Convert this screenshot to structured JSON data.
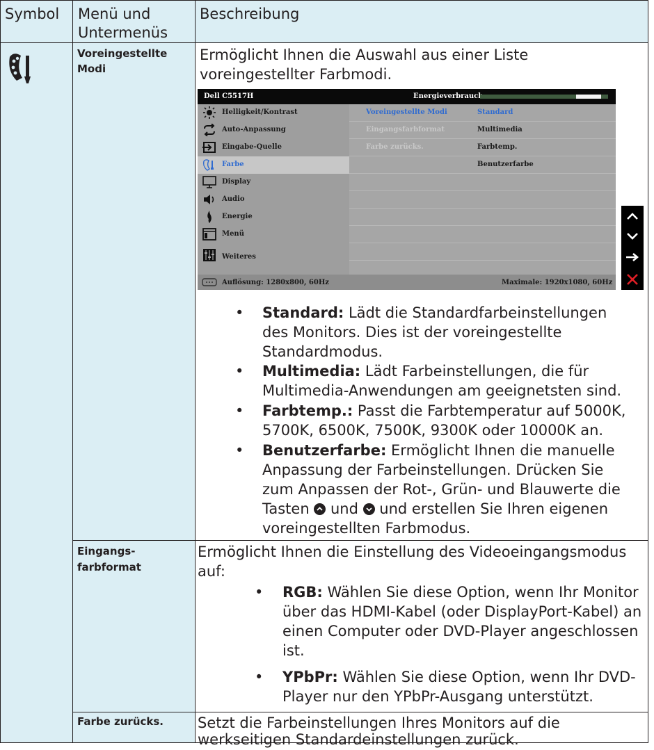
{
  "table_header": {
    "symbol": "Symbol",
    "menu_line1": "Menü und",
    "menu_line2": "Untermenüs",
    "description": "Beschreibung"
  },
  "rows": [
    {
      "menu_line1": "Voreingestellte",
      "menu_line2": "Modi",
      "desc_line1": "Ermöglicht Ihnen die Auswahl aus einer Liste",
      "desc_line2": "voreingestellter Farbmodi.",
      "bullets": [
        {
          "label": "Standard:",
          "lines": [
            " Lädt die Standardfarbeinstellungen",
            "des Monitors. Dies ist der voreingestellte",
            "Standardmodus."
          ]
        },
        {
          "label": "Multimedia:",
          "lines": [
            " Lädt Farbeinstellungen, die für",
            "Multimedia-Anwendungen am geeignetsten sind."
          ]
        },
        {
          "label": "Farbtemp.:",
          "lines": [
            " Passt die Farbtemperatur auf 5000K,",
            "5700K, 6500K, 7500K, 9300K oder 10000K an."
          ]
        },
        {
          "label": "Benutzerfarbe:",
          "lines": [
            " Ermöglicht Ihnen die manuelle",
            "Anpassung der Farbeinstellungen. Drücken Sie",
            "zum Anpassen der Rot-, Grün- und Blauwerte die"
          ],
          "line4_a": "Tasten ",
          "line4_b": " und ",
          "line4_c": " und erstellen Sie Ihren eigenen",
          "line5": "voreingestellten Farbmodus."
        }
      ]
    },
    {
      "menu_line1": "Eingangs-",
      "menu_line2": "farbformat",
      "desc_line1": "Ermöglicht Ihnen die Einstellung des Videoeingangsmodus",
      "desc_line2": "auf:",
      "bullets": [
        {
          "label": "RGB:",
          "lines": [
            " Wählen Sie diese Option, wenn Ihr Monitor",
            "über das HDMI-Kabel (oder DisplayPort-Kabel) an",
            "einen Computer oder DVD-Player angeschlossen",
            "ist."
          ]
        },
        {
          "label": "YPbPr:",
          "lines": [
            " Wählen Sie diese Option, wenn Ihr DVD-",
            "Player nur den YPbPr-Ausgang unterstützt."
          ]
        }
      ]
    },
    {
      "menu_line1": "Farbe zurücks.",
      "desc_line1": "Setzt die Farbeinstellungen Ihres Monitors auf die",
      "desc_line2": "werkseitigen Standardeinstellungen zurück."
    }
  ],
  "osd": {
    "model": "Dell C5517H",
    "energy_label": "Energieverbrauch",
    "energy_level": 0.8,
    "menu": [
      "Helligkeit/Kontrast",
      "Auto-Anpassung",
      "Eingabe-Quelle",
      "Farbe",
      "Display",
      "Audio",
      "Energie",
      "Menü",
      "Weiteres"
    ],
    "selected_menu": "Farbe",
    "submenu": [
      "Voreingestellte Modi",
      "Eingangsfarbformat",
      "Farbe zurücks."
    ],
    "options": [
      "Standard",
      "Multimedia",
      "Farbtemp.",
      "Benutzerfarbe"
    ],
    "resolution": "Auflösung: 1280x800, 60Hz",
    "max_resolution": "Maximale: 1920x1080, 60Hz",
    "colors": {
      "selected": "#2f6bd0",
      "disabled": "#c8c8c8",
      "panel": "#a6a6a6"
    }
  },
  "nav_buttons": [
    "up-icon",
    "down-icon",
    "enter-icon",
    "close-icon"
  ]
}
